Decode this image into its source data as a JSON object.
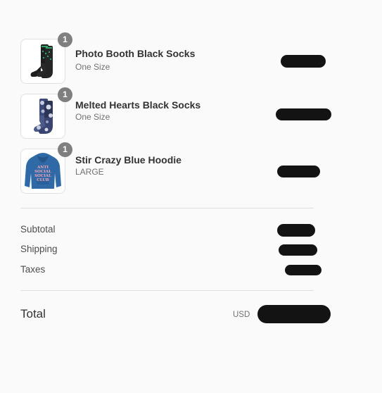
{
  "items": [
    {
      "name": "Photo Booth Black Socks",
      "variant": "One Size",
      "quantity": "1",
      "thumb_icon": "black-socks-image"
    },
    {
      "name": "Melted Hearts Black Socks",
      "variant": "One Size",
      "quantity": "1",
      "thumb_icon": "tie-dye-socks-image"
    },
    {
      "name": "Stir Crazy Blue Hoodie",
      "variant": "LARGE",
      "quantity": "1",
      "thumb_icon": "blue-hoodie-image"
    }
  ],
  "costs": {
    "subtotal_label": "Subtotal",
    "shipping_label": "Shipping",
    "taxes_label": "Taxes"
  },
  "total": {
    "label": "Total",
    "currency": "USD"
  },
  "colors": {
    "background": "#fafafa",
    "redaction": "#131313",
    "badge": "#7f7f7f",
    "hoodie": "#2f6aa6",
    "hoodie_text": "#f3a3b7"
  }
}
